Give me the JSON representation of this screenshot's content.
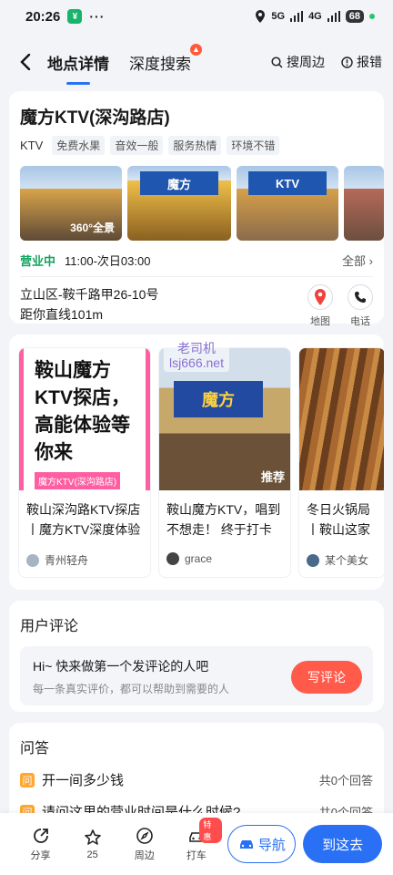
{
  "statusbar": {
    "time": "20:26",
    "badge": "¥",
    "dots": "···",
    "network": "5G",
    "network2": "4G",
    "battery": "68"
  },
  "nav": {
    "tabs": [
      "地点详情",
      "深度搜索"
    ],
    "actions": [
      "搜周边",
      "报错"
    ],
    "colors": {
      "accent": "#2a70f4"
    }
  },
  "poi": {
    "title": "魔方KTV(深沟路店)",
    "type": "KTV",
    "tags": [
      "免费水果",
      "音效一般",
      "服务热情",
      "环境不错"
    ],
    "pano_label": "360°全景",
    "photo_sign": "魔方",
    "photo_sign2": "KTV",
    "status": "营业中",
    "hours": "11:00-次日03:00",
    "hours_all": "全部",
    "address": "立山区-鞍千路甲26-10号",
    "distance": "距你直线101m",
    "map_label": "地图",
    "phone_label": "电话"
  },
  "notes": [
    {
      "cover_text": "鞍山魔方KTV探店，高能体验等你来",
      "cover_label": "魔方KTV(深沟路店)",
      "caption": "鞍山深沟路KTV探店丨魔方KTV深度体验",
      "author": "青州轻舟"
    },
    {
      "cover_sign": "魔方",
      "badge": "推荐",
      "caption": "鞍山魔方KTV，唱到不想走！ 终于打卡了",
      "author": "grace"
    },
    {
      "caption": "冬日火锅局丨鞍山这家宝藏串儿",
      "author": "某个美女"
    }
  ],
  "watermark": {
    "line1": "老司机",
    "line2": "lsj666.net"
  },
  "reviews": {
    "title": "用户评论",
    "hint": "Hi~ 快来做第一个发评论的人吧",
    "sub": "每一条真实评价，都可以帮助到需要的人",
    "button": "写评论"
  },
  "qa": {
    "title": "问答",
    "icon": "问",
    "items": [
      {
        "question": "开一间多少钱",
        "count": "共0个回答"
      },
      {
        "question": "请问这里的营业时间是什么时候?",
        "count": "共0个回答"
      }
    ]
  },
  "bottom": {
    "items": [
      {
        "label": "分享",
        "icon": "share-icon"
      },
      {
        "label": "25",
        "icon": "star-icon"
      },
      {
        "label": "周边",
        "icon": "compass-icon"
      },
      {
        "label": "打车",
        "icon": "taxi-icon",
        "hot": "特惠"
      }
    ],
    "navigate": "导航",
    "go": "到这去"
  }
}
